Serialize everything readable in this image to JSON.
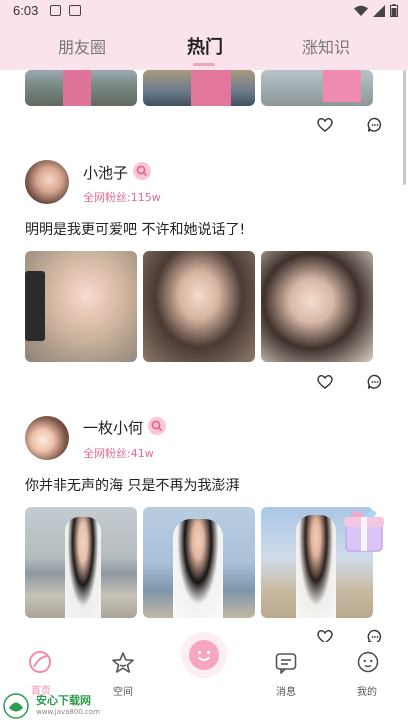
{
  "status": {
    "time": "6:03"
  },
  "header": {
    "tabs": [
      {
        "label": "朋友圈"
      },
      {
        "label": "热门"
      },
      {
        "label": "涨知识"
      }
    ],
    "active_tab": "热门"
  },
  "posts": [
    {
      "username": "小池子",
      "fans": "全网粉丝:115w",
      "text": "明明是我更可爱吧 不许和她说话了!"
    },
    {
      "username": "一枚小何",
      "fans": "全网粉丝:41w",
      "text": "你并非无声的海 只是不再为我澎湃"
    }
  ],
  "nav": {
    "items": [
      {
        "label": "首页"
      },
      {
        "label": "空间"
      },
      {
        "label": ""
      },
      {
        "label": "消息"
      },
      {
        "label": "我的"
      }
    ]
  },
  "watermark": {
    "text": "安心下载网",
    "url": "www.java800.com"
  },
  "colors": {
    "header_bg": "#fbe3ec",
    "accent": "#f48aa8",
    "fans_text": "#e46b8f"
  }
}
